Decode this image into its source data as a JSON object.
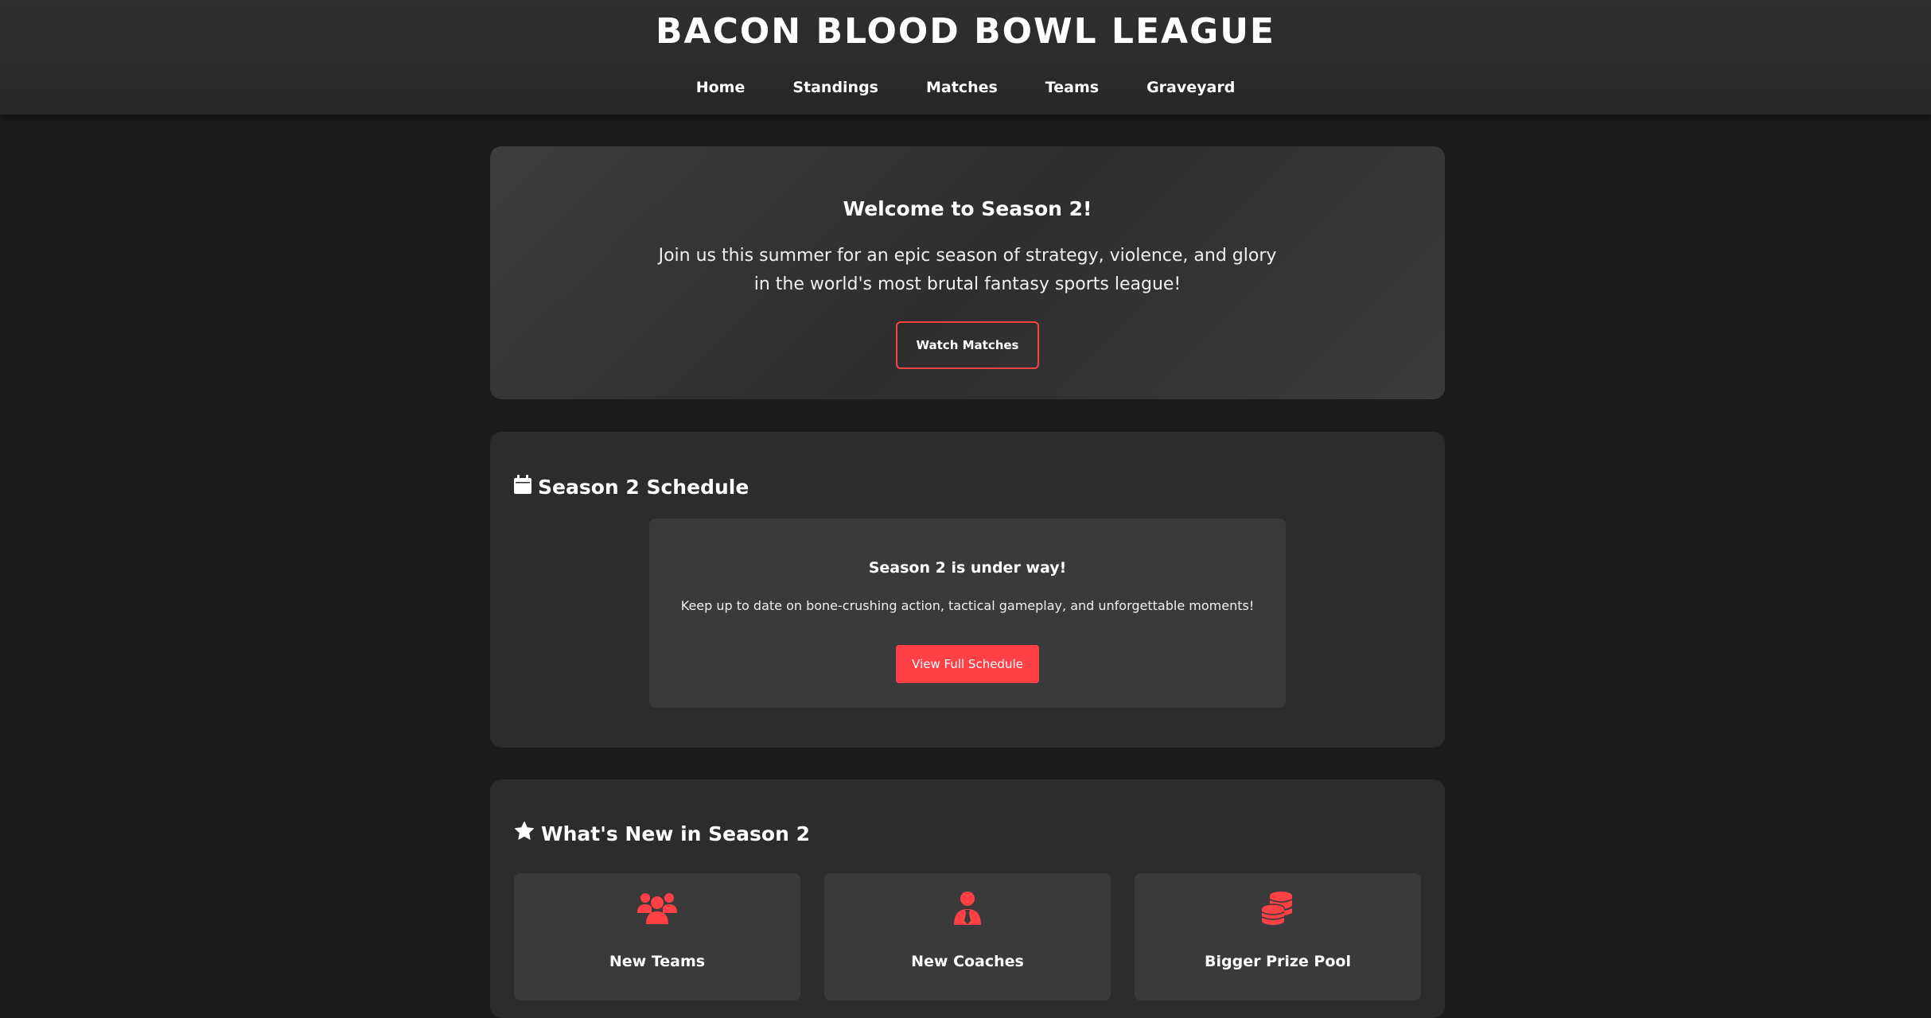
{
  "site": {
    "title": "BACON BLOOD BOWL LEAGUE"
  },
  "nav": {
    "items": [
      "Home",
      "Standings",
      "Matches",
      "Teams",
      "Graveyard"
    ]
  },
  "hero": {
    "title": "Welcome to Season 2!",
    "text": "Join us this summer for an epic season of strategy, violence, and glory in the world's most brutal fantasy sports league!",
    "button_label": "Watch Matches"
  },
  "schedule": {
    "icon": "calendar-icon",
    "title": "Season 2 Schedule",
    "box_title": "Season 2 is under way!",
    "box_text": "Keep up to date on bone-crushing action, tactical gameplay, and unforgettable moments!",
    "button_label": "View Full Schedule"
  },
  "whats_new": {
    "icon": "star-icon",
    "title": "What's New in Season 2",
    "features": [
      {
        "label": "New Teams",
        "icon": "users-icon"
      },
      {
        "label": "New Coaches",
        "icon": "user-tie-icon"
      },
      {
        "label": "Bigger Prize Pool",
        "icon": "coins-icon"
      }
    ]
  },
  "colors": {
    "accent": "#ff4044",
    "background": "#1b1b1b",
    "card": "#2c2c2c",
    "inner_card": "#3a3a3a"
  }
}
